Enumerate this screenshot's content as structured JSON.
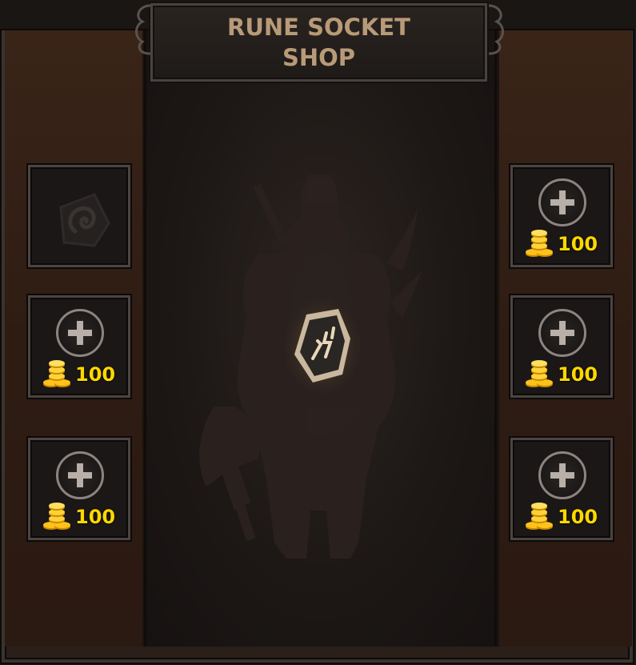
{
  "title": "RUNE SOCKET SHOP",
  "title_lines": [
    "RUNE SOCKET",
    "SHOP"
  ],
  "colors": {
    "title": "#b89a78",
    "price": "#ffd700",
    "side_panel": "#3a2418",
    "center_panel": "#1d1816",
    "slot_border": "#4b4440"
  },
  "left_slots": [
    {
      "state": "locked-rune",
      "icon": "spiral-rune-icon"
    },
    {
      "state": "buy",
      "icon": "plus-icon",
      "price": "100",
      "currency_icon": "gold-coins-icon"
    },
    {
      "state": "buy",
      "icon": "plus-icon",
      "price": "100",
      "currency_icon": "gold-coins-icon"
    }
  ],
  "right_slots": [
    {
      "state": "buy",
      "icon": "plus-icon",
      "price": "100",
      "currency_icon": "gold-coins-icon"
    },
    {
      "state": "buy",
      "icon": "plus-icon",
      "price": "100",
      "currency_icon": "gold-coins-icon"
    },
    {
      "state": "buy",
      "icon": "plus-icon",
      "price": "100",
      "currency_icon": "gold-coins-icon"
    }
  ],
  "center": {
    "silhouette": "warrior-silhouette",
    "socket_icon": "rune-stone-icon"
  }
}
